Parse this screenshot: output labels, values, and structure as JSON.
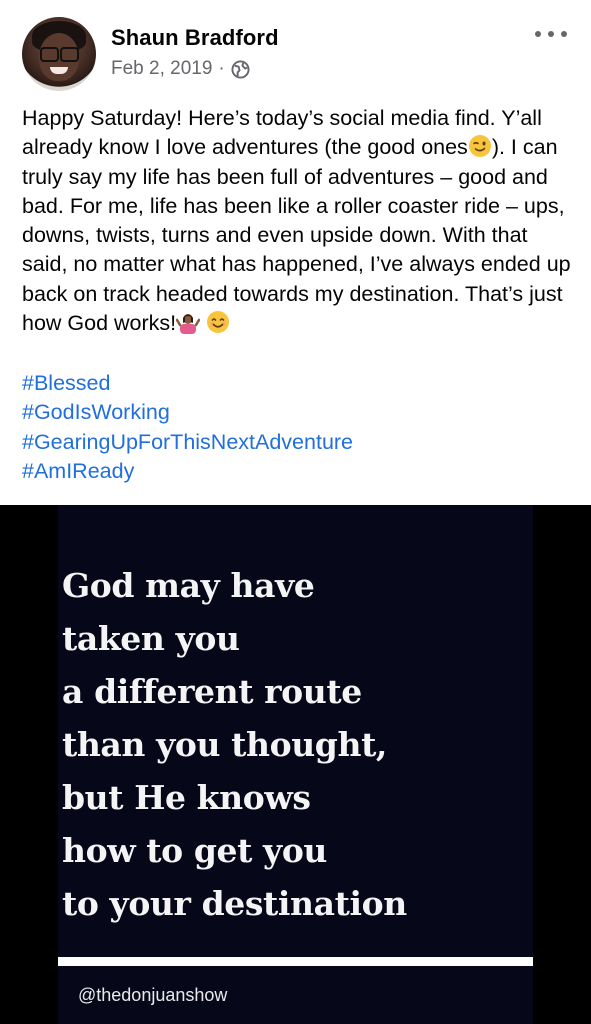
{
  "post": {
    "author": "Shaun Bradford",
    "date": "Feb 2, 2019",
    "separator": "·",
    "audience_icon": "globe-icon",
    "more_icon": "more-horizontal-icon",
    "text_1": "Happy Saturday! Here’s today’s social media find. Y’all already know I love adventures (the good ones",
    "text_2": "). I can truly say my life has been full of adventures – good and bad. For me, life has been like a roller coaster ride – ups, downs, twists, turns and even upside down. With that said, no matter what has happened, I’ve always ended up back on track headed towards my destination. That’s just how God works!",
    "emojis": [
      "winking-face-emoji",
      "woman-shrugging-emoji",
      "smiling-face-emoji"
    ],
    "hashtags": [
      "#Blessed",
      "#GodIsWorking",
      "#GearingUpForThisNextAdventure",
      "#AmIReady"
    ]
  },
  "image": {
    "quote": "God may have\ntaken you\na different route\nthan you thought,\nbut He knows\nhow to get you\nto your destination",
    "credit": "@thedonjuanshow"
  },
  "colors": {
    "hashtag": "#216fdb",
    "meta": "#65676b",
    "image_background": "#07071a"
  }
}
